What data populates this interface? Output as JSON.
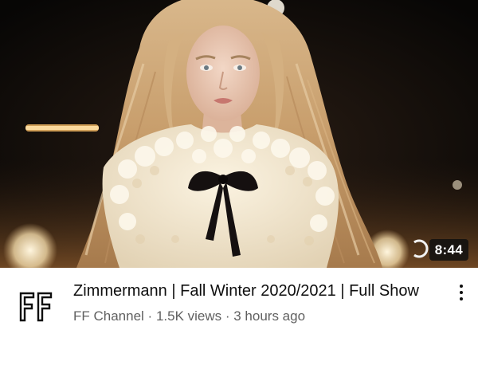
{
  "video": {
    "thumbnail_icon": "runway-model-photo",
    "duration": "8:44",
    "title": "Zimmermann | Fall Winter 2020/2021 | Full Show",
    "channel_avatar_icon": "ff-logo-icon",
    "meta": {
      "channel": "FF Channel",
      "separator": " · ",
      "views": "1.5K views",
      "age": "3 hours ago"
    },
    "more_icon": "more-vertical-icon"
  },
  "colors": {
    "title": "#0f0f0f",
    "meta": "#606060",
    "badge_bg": "#0f0f0f",
    "badge_text": "#ffffff"
  }
}
